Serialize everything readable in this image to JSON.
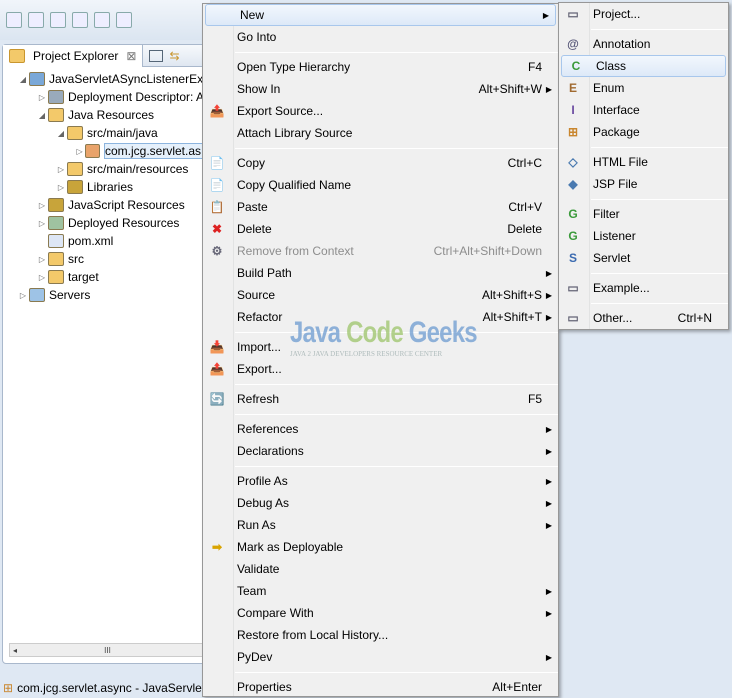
{
  "toolbar": {
    "icons": [
      "new-icon",
      "save-icon",
      "save-all-icon",
      "print-icon",
      "binary-icon",
      "skip-breakpoints-icon"
    ]
  },
  "explorer": {
    "tab_label": "Project Explorer",
    "close": "⊠",
    "tree": [
      {
        "label": "JavaServletASyncListenerEx",
        "depth": 0,
        "tw": "◢",
        "icon": "project",
        "color": "#7aa8d8"
      },
      {
        "label": "Deployment Descriptor: A",
        "depth": 1,
        "tw": "▷",
        "icon": "descriptor",
        "color": "#9ab"
      },
      {
        "label": "Java Resources",
        "depth": 1,
        "tw": "◢",
        "icon": "folder",
        "color": "#f3c96a"
      },
      {
        "label": "src/main/java",
        "depth": 2,
        "tw": "◢",
        "icon": "folder",
        "color": "#f3c96a"
      },
      {
        "label": "com.jcg.servlet.as",
        "depth": 3,
        "tw": "▷",
        "icon": "package",
        "color": "#e9a36a",
        "selected": true
      },
      {
        "label": "src/main/resources",
        "depth": 2,
        "tw": "▷",
        "icon": "folder",
        "color": "#f3c96a"
      },
      {
        "label": "Libraries",
        "depth": 2,
        "tw": "▷",
        "icon": "library",
        "color": "#c8a43a"
      },
      {
        "label": "JavaScript Resources",
        "depth": 1,
        "tw": "▷",
        "icon": "library",
        "color": "#c8a43a"
      },
      {
        "label": "Deployed Resources",
        "depth": 1,
        "tw": "▷",
        "icon": "folder",
        "color": "#9fc2a0"
      },
      {
        "label": "pom.xml",
        "depth": 1,
        "tw": "",
        "icon": "maven-file",
        "color": "#dde6f5"
      },
      {
        "label": "src",
        "depth": 1,
        "tw": "▷",
        "icon": "folder",
        "color": "#f3c96a"
      },
      {
        "label": "target",
        "depth": 1,
        "tw": "▷",
        "icon": "folder",
        "color": "#f3c96a"
      },
      {
        "label": "Servers",
        "depth": 0,
        "tw": "▷",
        "icon": "folder",
        "color": "#9ec3e6"
      }
    ],
    "scroll_thumb": "III"
  },
  "status": {
    "text": "com.jcg.servlet.async - JavaServlet"
  },
  "context_menu": [
    {
      "label": "New",
      "arrow": true,
      "hl": true
    },
    {
      "label": "Go Into"
    },
    {
      "sep": true
    },
    {
      "label": "Open Type Hierarchy",
      "sc": "F4"
    },
    {
      "label": "Show In",
      "sc": "Alt+Shift+W",
      "arrow": true
    },
    {
      "label": "Export Source...",
      "icon": "📤"
    },
    {
      "label": "Attach Library Source"
    },
    {
      "sep": true
    },
    {
      "label": "Copy",
      "sc": "Ctrl+C",
      "icon": "📄"
    },
    {
      "label": "Copy Qualified Name",
      "icon": "📄"
    },
    {
      "label": "Paste",
      "sc": "Ctrl+V",
      "icon": "📋"
    },
    {
      "label": "Delete",
      "sc": "Delete",
      "icon": "✖",
      "iconColor": "#d22"
    },
    {
      "label": "Remove from Context",
      "sc": "Ctrl+Alt+Shift+Down",
      "dis": true,
      "icon": "⚙"
    },
    {
      "label": "Build Path",
      "arrow": true
    },
    {
      "label": "Source",
      "sc": "Alt+Shift+S",
      "arrow": true
    },
    {
      "label": "Refactor",
      "sc": "Alt+Shift+T",
      "arrow": true
    },
    {
      "sep": true
    },
    {
      "label": "Import...",
      "icon": "📥"
    },
    {
      "label": "Export...",
      "icon": "📤"
    },
    {
      "sep": true
    },
    {
      "label": "Refresh",
      "sc": "F5",
      "icon": "🔄"
    },
    {
      "sep": true
    },
    {
      "label": "References",
      "arrow": true
    },
    {
      "label": "Declarations",
      "arrow": true
    },
    {
      "sep": true
    },
    {
      "label": "Profile As",
      "arrow": true
    },
    {
      "label": "Debug As",
      "arrow": true
    },
    {
      "label": "Run As",
      "arrow": true
    },
    {
      "label": "Mark as Deployable",
      "icon": "➡",
      "iconColor": "#d9a400"
    },
    {
      "label": "Validate"
    },
    {
      "label": "Team",
      "arrow": true
    },
    {
      "label": "Compare With",
      "arrow": true
    },
    {
      "label": "Restore from Local History..."
    },
    {
      "label": "PyDev",
      "arrow": true
    },
    {
      "sep": true
    },
    {
      "label": "Properties",
      "sc": "Alt+Enter"
    }
  ],
  "new_submenu": [
    {
      "label": "Project...",
      "icon": "▭"
    },
    {
      "sep": true
    },
    {
      "label": "Annotation",
      "icon": "@",
      "iconColor": "#557"
    },
    {
      "label": "Class",
      "icon": "C",
      "iconColor": "#3a9a3a",
      "hl": true
    },
    {
      "label": "Enum",
      "icon": "E",
      "iconColor": "#a06a30"
    },
    {
      "label": "Interface",
      "icon": "I",
      "iconColor": "#6a4aa0"
    },
    {
      "label": "Package",
      "icon": "⊞",
      "iconColor": "#c9862e"
    },
    {
      "sep": true
    },
    {
      "label": "HTML File",
      "icon": "◇",
      "iconColor": "#4a7ab0"
    },
    {
      "label": "JSP File",
      "icon": "◆",
      "iconColor": "#4a7ab0"
    },
    {
      "sep": true
    },
    {
      "label": "Filter",
      "icon": "G",
      "iconColor": "#3a9a3a"
    },
    {
      "label": "Listener",
      "icon": "G",
      "iconColor": "#3a9a3a"
    },
    {
      "label": "Servlet",
      "icon": "S",
      "iconColor": "#3a6ab0"
    },
    {
      "sep": true
    },
    {
      "label": "Example...",
      "icon": "▭"
    },
    {
      "sep": true
    },
    {
      "label": "Other...",
      "sc": "Ctrl+N",
      "icon": "▭"
    }
  ],
  "watermark": {
    "title_java": "Java",
    "title_code": "Code",
    "title_geeks": "Geeks",
    "subtitle": "JAVA 2 JAVA DEVELOPERS RESOURCE CENTER"
  }
}
